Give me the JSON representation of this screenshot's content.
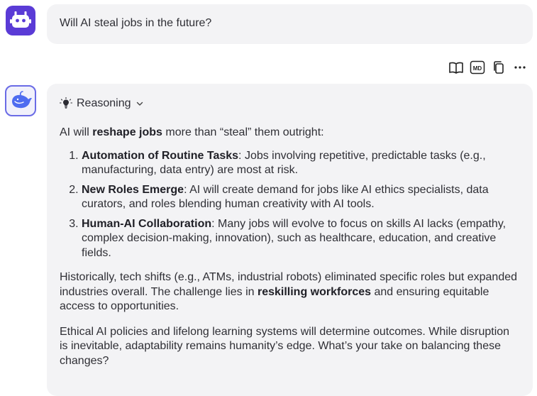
{
  "user": {
    "message": "Will AI steal jobs in the future?"
  },
  "actions": [
    "book-icon",
    "markdown-icon",
    "copy-icon",
    "more-icon"
  ],
  "assistant": {
    "reasoning_label": "Reasoning",
    "intro": {
      "a": "AI will ",
      "b": "reshape jobs",
      "c": " more than “steal” them outright:"
    },
    "items": [
      {
        "title": "Automation of Routine Tasks",
        "text": ": Jobs involving repetitive, predictable tasks (e.g., manufacturing, data entry) are most at risk."
      },
      {
        "title": "New Roles Emerge",
        "text": ": AI will create demand for jobs like AI ethics specialists, data curators, and roles blending human creativity with AI tools."
      },
      {
        "title": "Human-AI Collaboration",
        "text": ": Many jobs will evolve to focus on skills AI lacks (empathy, complex decision-making, innovation), such as healthcare, education, and creative fields."
      }
    ],
    "para2": {
      "a": "Historically, tech shifts (e.g., ATMs, industrial robots) eliminated specific roles but expanded industries overall. The challenge lies in ",
      "b": "reskilling workforces",
      "c": " and ensuring equitable access to opportunities."
    },
    "para3": "Ethical AI policies and lifelong learning systems will determine outcomes. While disruption is inevitable, adaptability remains humanity’s edge. What’s your take on balancing these changes?"
  },
  "colors": {
    "user_avatar": "#5a3bd6",
    "bot_avatar_border": "#6a6be6",
    "bubble": "#f3f3f5"
  }
}
